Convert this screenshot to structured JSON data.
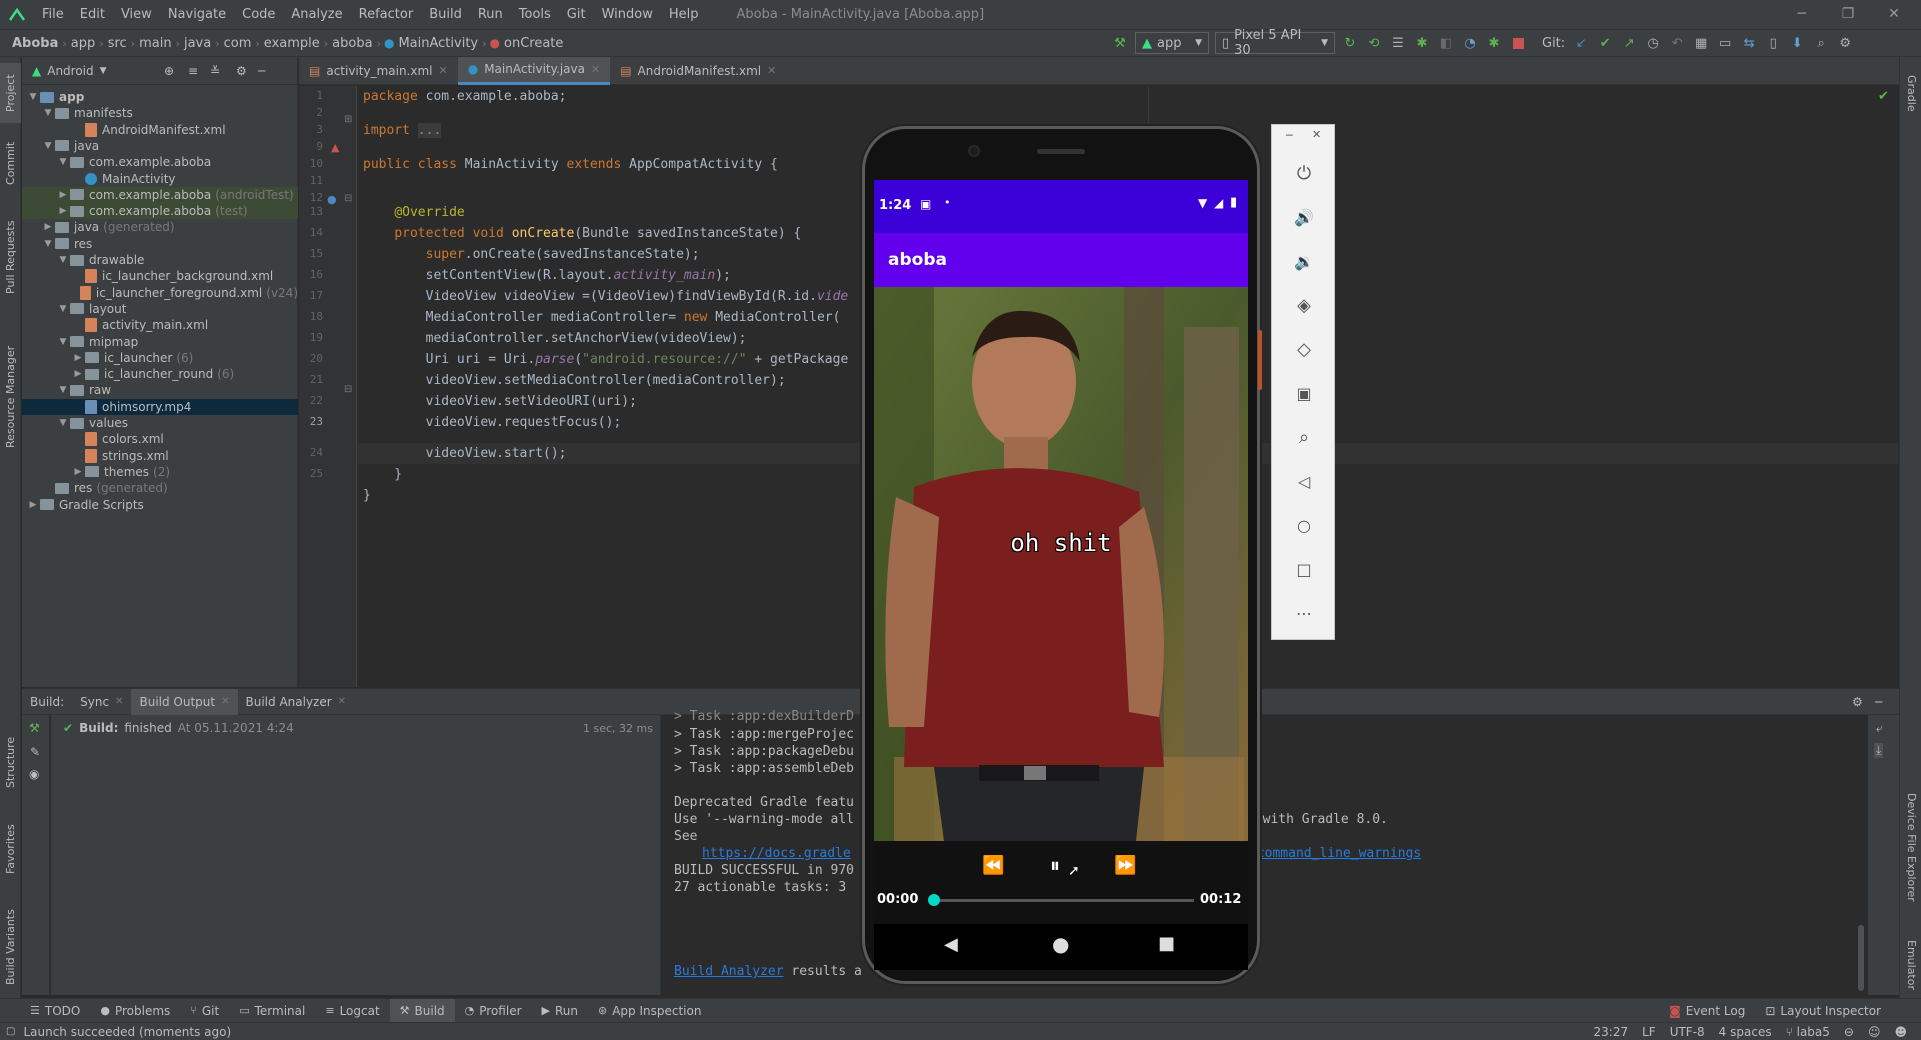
{
  "window": {
    "title": "Aboba - MainActivity.java [Aboba.app]",
    "menu": [
      "File",
      "Edit",
      "View",
      "Navigate",
      "Code",
      "Analyze",
      "Refactor",
      "Build",
      "Run",
      "Tools",
      "Git",
      "Window",
      "Help"
    ]
  },
  "breadcrumb": [
    "Aboba",
    "app",
    "src",
    "main",
    "java",
    "com",
    "example",
    "aboba",
    "MainActivity",
    "onCreate"
  ],
  "toolbar": {
    "run_config": "app",
    "device": "Pixel 5 API 30",
    "git_label": "Git:"
  },
  "project_panel": {
    "view": "Android",
    "tree": [
      {
        "label": "app",
        "extra": "",
        "depth": 0,
        "type": "module",
        "open": true
      },
      {
        "label": "manifests",
        "extra": "",
        "depth": 1,
        "type": "folder",
        "open": true
      },
      {
        "label": "AndroidManifest.xml",
        "extra": "",
        "depth": 3,
        "type": "xml"
      },
      {
        "label": "java",
        "extra": "",
        "depth": 1,
        "type": "folder",
        "open": true
      },
      {
        "label": "com.example.aboba",
        "extra": "",
        "depth": 2,
        "type": "pkg",
        "open": true
      },
      {
        "label": "MainActivity",
        "extra": "",
        "depth": 3,
        "type": "java"
      },
      {
        "label": "com.example.aboba",
        "extra": "(androidTest)",
        "depth": 2,
        "type": "pkg",
        "open": false,
        "hl": true
      },
      {
        "label": "com.example.aboba",
        "extra": "(test)",
        "depth": 2,
        "type": "pkg",
        "open": false,
        "hl": true
      },
      {
        "label": "java",
        "extra": "(generated)",
        "depth": 1,
        "type": "folder",
        "open": false
      },
      {
        "label": "res",
        "extra": "",
        "depth": 1,
        "type": "folder",
        "open": true
      },
      {
        "label": "drawable",
        "extra": "",
        "depth": 2,
        "type": "folder",
        "open": true
      },
      {
        "label": "ic_launcher_background.xml",
        "extra": "",
        "depth": 3,
        "type": "xml"
      },
      {
        "label": "ic_launcher_foreground.xml",
        "extra": "(v24)",
        "depth": 3,
        "type": "xml"
      },
      {
        "label": "layout",
        "extra": "",
        "depth": 2,
        "type": "folder",
        "open": true
      },
      {
        "label": "activity_main.xml",
        "extra": "",
        "depth": 3,
        "type": "xml"
      },
      {
        "label": "mipmap",
        "extra": "",
        "depth": 2,
        "type": "folder",
        "open": true
      },
      {
        "label": "ic_launcher",
        "extra": "(6)",
        "depth": 3,
        "type": "folder",
        "open": false
      },
      {
        "label": "ic_launcher_round",
        "extra": "(6)",
        "depth": 3,
        "type": "folder",
        "open": false
      },
      {
        "label": "raw",
        "extra": "",
        "depth": 2,
        "type": "folder",
        "open": true
      },
      {
        "label": "ohimsorry.mp4",
        "extra": "",
        "depth": 3,
        "type": "mp4",
        "selected": true
      },
      {
        "label": "values",
        "extra": "",
        "depth": 2,
        "type": "folder",
        "open": true
      },
      {
        "label": "colors.xml",
        "extra": "",
        "depth": 3,
        "type": "xml"
      },
      {
        "label": "strings.xml",
        "extra": "",
        "depth": 3,
        "type": "xml"
      },
      {
        "label": "themes",
        "extra": "(2)",
        "depth": 3,
        "type": "folder",
        "open": false
      },
      {
        "label": "res",
        "extra": "(generated)",
        "depth": 1,
        "type": "folder",
        "noarrow": true
      },
      {
        "label": "Gradle Scripts",
        "extra": "",
        "depth": 0,
        "type": "gradle",
        "open": false
      }
    ]
  },
  "editor": {
    "tabs": [
      {
        "label": "activity_main.xml",
        "active": false
      },
      {
        "label": "MainActivity.java",
        "active": true
      },
      {
        "label": "AndroidManifest.xml",
        "active": false
      }
    ],
    "line_numbers": [
      "1",
      "2",
      "3",
      "9",
      "10",
      "11",
      "12",
      "13",
      "14",
      "15",
      "16",
      "17",
      "18",
      "19",
      "20",
      "21",
      "22",
      "23",
      "24",
      "25"
    ],
    "current_line_index": 17
  },
  "left_tool_tabs": [
    "Project",
    "Commit",
    "Pull Requests",
    "Resource Manager",
    "Structure",
    "Favorites",
    "Build Variants"
  ],
  "right_tool_tabs": [
    "Gradle",
    "Device File Explorer",
    "Emulator"
  ],
  "build": {
    "tabs": [
      "Build:",
      "Sync",
      "Build Output",
      "Build Analyzer"
    ],
    "result_label": "Build:",
    "result_text": "finished",
    "result_time": "At 05.11.2021 4:24",
    "duration": "1 sec, 32 ms",
    "output_lines": [
      "> Task :app:mergeProjec",
      "> Task :app:packageDebu",
      "> Task :app:assembleDeb",
      "",
      "Deprecated Gradle featu",
      "Use '--warning-mode all",
      "See ",
      "",
      "BUILD SUCCESSFUL in 970",
      "27 actionable tasks: 3",
      ""
    ],
    "docs_link": "https://docs.gradle",
    "analyzer_link": "Build Analyzer",
    "analyzer_tail": " results a",
    "right_fragment_1": "e with Gradle 8.0.",
    "right_fragment_2": ":command_line_warnings"
  },
  "bottom_tools": [
    "TODO",
    "Problems",
    "Git",
    "Terminal",
    "Logcat",
    "Build",
    "Profiler",
    "Run",
    "App Inspection"
  ],
  "bottom_right_tools": [
    "Event Log",
    "Layout Inspector"
  ],
  "status": {
    "message": "Launch succeeded (moments ago)",
    "position": "23:27",
    "line_sep": "LF",
    "encoding": "UTF-8",
    "indent": "4 spaces",
    "branch": "laba5"
  },
  "phone": {
    "time": "1:24",
    "app_title": "aboba",
    "subtitle": "oh shit",
    "time_current": "00:00",
    "time_total": "00:12",
    "progress": 0.0,
    "colors": {
      "status": "#3b00d7",
      "app_bar": "#6200ee",
      "seek": "#03dac5"
    }
  }
}
